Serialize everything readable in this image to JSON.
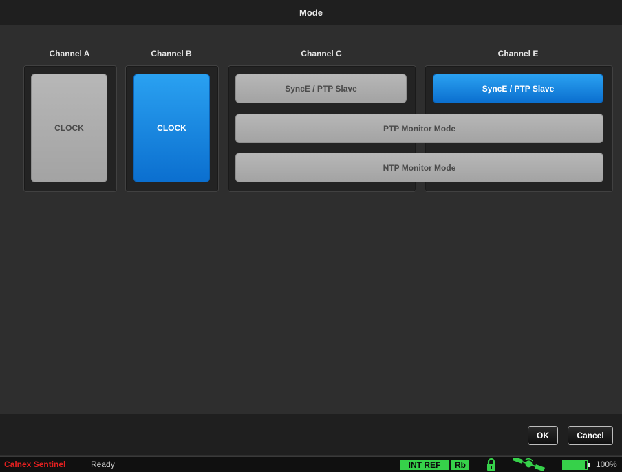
{
  "window": {
    "title": "Mode"
  },
  "channels": {
    "a": {
      "header": "Channel A",
      "clock_label": "CLOCK"
    },
    "b": {
      "header": "Channel B",
      "clock_label": "CLOCK"
    },
    "c": {
      "header": "Channel C",
      "synce_label": "SyncE / PTP Slave"
    },
    "e": {
      "header": "Channel E",
      "synce_label": "SyncE / PTP Slave"
    },
    "shared": {
      "ptp_monitor_label": "PTP Monitor Mode",
      "ntp_monitor_label": "NTP Monitor Mode"
    }
  },
  "dialog": {
    "ok_label": "OK",
    "cancel_label": "Cancel"
  },
  "status": {
    "brand": "Calnex Sentinel",
    "state": "Ready",
    "ref_badge": "INT REF",
    "osc_badge": "Rb",
    "battery_percent": "100%",
    "battery_level": 0.9,
    "icons": [
      "lock-icon",
      "satellite-icon",
      "battery-icon"
    ]
  },
  "colors": {
    "selected": "#0b7fe0",
    "unselected": "#adadad",
    "status_green": "#36d14a",
    "brand_red": "#e02020"
  }
}
